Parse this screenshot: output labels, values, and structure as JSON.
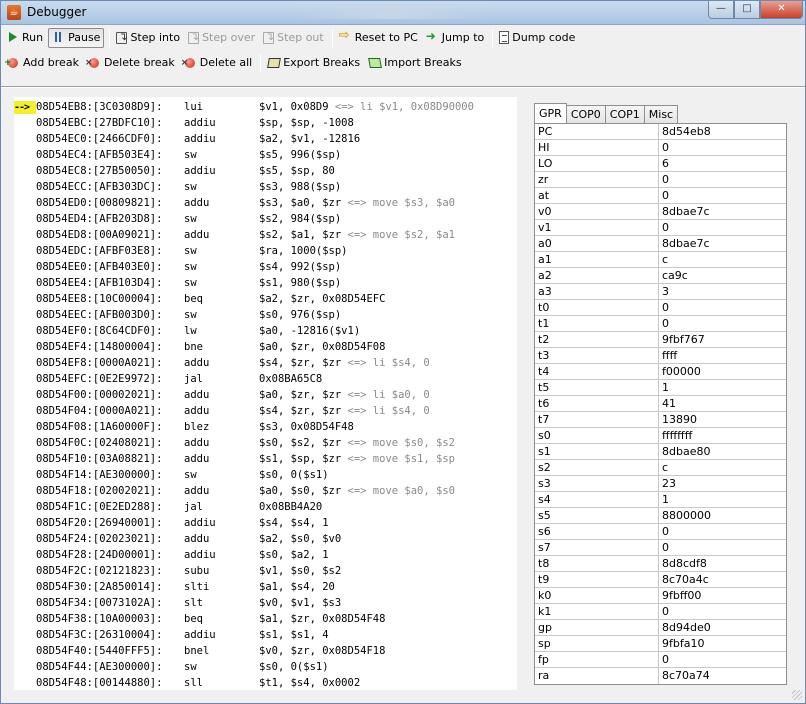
{
  "window": {
    "title": "Debugger",
    "controls": {
      "minimize": "—",
      "maximize": "□",
      "close": "✕"
    }
  },
  "toolbar1": {
    "run": "Run",
    "pause": "Pause",
    "step_into": "Step into",
    "step_over": "Step over",
    "step_out": "Step out",
    "reset_to_pc": "Reset to PC",
    "jump_to": "Jump to",
    "dump_code": "Dump code"
  },
  "toolbar2": {
    "add_break": "Add break",
    "delete_break": "Delete break",
    "delete_all": "Delete all",
    "export_breaks": "Export Breaks",
    "import_breaks": "Import Breaks"
  },
  "disassembly": {
    "pc_marker": "-->",
    "current_index": 0,
    "rows": [
      {
        "addr": "08D54EB8:[3C0308D9]:",
        "op": "lui",
        "args": "$v1, 0x08D9",
        "note": "<=> li $v1, 0x08D90000"
      },
      {
        "addr": "08D54EBC:[27BDFC10]:",
        "op": "addiu",
        "args": "$sp, $sp, -1008",
        "note": ""
      },
      {
        "addr": "08D54EC0:[2466CDF0]:",
        "op": "addiu",
        "args": "$a2, $v1, -12816",
        "note": ""
      },
      {
        "addr": "08D54EC4:[AFB503E4]:",
        "op": "sw",
        "args": "$s5, 996($sp)",
        "note": ""
      },
      {
        "addr": "08D54EC8:[27B50050]:",
        "op": "addiu",
        "args": "$s5, $sp, 80",
        "note": ""
      },
      {
        "addr": "08D54ECC:[AFB303DC]:",
        "op": "sw",
        "args": "$s3, 988($sp)",
        "note": ""
      },
      {
        "addr": "08D54ED0:[00809821]:",
        "op": "addu",
        "args": "$s3, $a0, $zr",
        "note": "<=> move $s3, $a0"
      },
      {
        "addr": "08D54ED4:[AFB203D8]:",
        "op": "sw",
        "args": "$s2, 984($sp)",
        "note": ""
      },
      {
        "addr": "08D54ED8:[00A09021]:",
        "op": "addu",
        "args": "$s2, $a1, $zr",
        "note": "<=> move $s2, $a1"
      },
      {
        "addr": "08D54EDC:[AFBF03E8]:",
        "op": "sw",
        "args": "$ra, 1000($sp)",
        "note": ""
      },
      {
        "addr": "08D54EE0:[AFB403E0]:",
        "op": "sw",
        "args": "$s4, 992($sp)",
        "note": ""
      },
      {
        "addr": "08D54EE4:[AFB103D4]:",
        "op": "sw",
        "args": "$s1, 980($sp)",
        "note": ""
      },
      {
        "addr": "08D54EE8:[10C00004]:",
        "op": "beq",
        "args": "$a2, $zr, 0x08D54EFC",
        "note": ""
      },
      {
        "addr": "08D54EEC:[AFB003D0]:",
        "op": "sw",
        "args": "$s0, 976($sp)",
        "note": ""
      },
      {
        "addr": "08D54EF0:[8C64CDF0]:",
        "op": "lw",
        "args": "$a0, -12816($v1)",
        "note": ""
      },
      {
        "addr": "08D54EF4:[14800004]:",
        "op": "bne",
        "args": "$a0, $zr, 0x08D54F08",
        "note": ""
      },
      {
        "addr": "08D54EF8:[0000A021]:",
        "op": "addu",
        "args": "$s4, $zr, $zr",
        "note": "<=> li $s4, 0"
      },
      {
        "addr": "08D54EFC:[0E2E9972]:",
        "op": "jal",
        "args": "0x08BA65C8",
        "note": ""
      },
      {
        "addr": "08D54F00:[00002021]:",
        "op": "addu",
        "args": "$a0, $zr, $zr",
        "note": "<=> li $a0, 0"
      },
      {
        "addr": "08D54F04:[0000A021]:",
        "op": "addu",
        "args": "$s4, $zr, $zr",
        "note": "<=> li $s4, 0"
      },
      {
        "addr": "08D54F08:[1A60000F]:",
        "op": "blez",
        "args": "$s3, 0x08D54F48",
        "note": ""
      },
      {
        "addr": "08D54F0C:[02408021]:",
        "op": "addu",
        "args": "$s0, $s2, $zr",
        "note": "<=> move $s0, $s2"
      },
      {
        "addr": "08D54F10:[03A08821]:",
        "op": "addu",
        "args": "$s1, $sp, $zr",
        "note": "<=> move $s1, $sp"
      },
      {
        "addr": "08D54F14:[AE300000]:",
        "op": "sw",
        "args": "$s0, 0($s1)",
        "note": ""
      },
      {
        "addr": "08D54F18:[02002021]:",
        "op": "addu",
        "args": "$a0, $s0, $zr",
        "note": "<=> move $a0, $s0"
      },
      {
        "addr": "08D54F1C:[0E2ED288]:",
        "op": "jal",
        "args": "0x08BB4A20",
        "note": ""
      },
      {
        "addr": "08D54F20:[26940001]:",
        "op": "addiu",
        "args": "$s4, $s4, 1",
        "note": ""
      },
      {
        "addr": "08D54F24:[02023021]:",
        "op": "addu",
        "args": "$a2, $s0, $v0",
        "note": ""
      },
      {
        "addr": "08D54F28:[24D00001]:",
        "op": "addiu",
        "args": "$s0, $a2, 1",
        "note": ""
      },
      {
        "addr": "08D54F2C:[02121823]:",
        "op": "subu",
        "args": "$v1, $s0, $s2",
        "note": ""
      },
      {
        "addr": "08D54F30:[2A850014]:",
        "op": "slti",
        "args": "$a1, $s4, 20",
        "note": ""
      },
      {
        "addr": "08D54F34:[0073102A]:",
        "op": "slt",
        "args": "$v0, $v1, $s3",
        "note": ""
      },
      {
        "addr": "08D54F38:[10A00003]:",
        "op": "beq",
        "args": "$a1, $zr, 0x08D54F48",
        "note": ""
      },
      {
        "addr": "08D54F3C:[26310004]:",
        "op": "addiu",
        "args": "$s1, $s1, 4",
        "note": ""
      },
      {
        "addr": "08D54F40:[5440FFF5]:",
        "op": "bnel",
        "args": "$v0, $zr, 0x08D54F18",
        "note": ""
      },
      {
        "addr": "08D54F44:[AE300000]:",
        "op": "sw",
        "args": "$s0, 0($s1)",
        "note": ""
      },
      {
        "addr": "08D54F48:[00144880]:",
        "op": "sll",
        "args": "$t1, $s4, 0x0002",
        "note": ""
      }
    ]
  },
  "register_tabs": [
    "GPR",
    "COP0",
    "COP1",
    "Misc"
  ],
  "active_tab": "GPR",
  "registers": [
    {
      "name": "PC",
      "value": "8d54eb8"
    },
    {
      "name": "HI",
      "value": "0"
    },
    {
      "name": "LO",
      "value": "6"
    },
    {
      "name": "zr",
      "value": "0"
    },
    {
      "name": "at",
      "value": "0"
    },
    {
      "name": "v0",
      "value": "8dbae7c"
    },
    {
      "name": "v1",
      "value": "0"
    },
    {
      "name": "a0",
      "value": "8dbae7c"
    },
    {
      "name": "a1",
      "value": "c"
    },
    {
      "name": "a2",
      "value": "ca9c"
    },
    {
      "name": "a3",
      "value": "3"
    },
    {
      "name": "t0",
      "value": "0"
    },
    {
      "name": "t1",
      "value": "0"
    },
    {
      "name": "t2",
      "value": "9fbf767"
    },
    {
      "name": "t3",
      "value": "ffff"
    },
    {
      "name": "t4",
      "value": "f00000"
    },
    {
      "name": "t5",
      "value": "1"
    },
    {
      "name": "t6",
      "value": "41"
    },
    {
      "name": "t7",
      "value": "13890"
    },
    {
      "name": "s0",
      "value": "ffffffff"
    },
    {
      "name": "s1",
      "value": "8dbae80"
    },
    {
      "name": "s2",
      "value": "c"
    },
    {
      "name": "s3",
      "value": "23"
    },
    {
      "name": "s4",
      "value": "1"
    },
    {
      "name": "s5",
      "value": "8800000"
    },
    {
      "name": "s6",
      "value": "0"
    },
    {
      "name": "s7",
      "value": "0"
    },
    {
      "name": "t8",
      "value": "8d8cdf8"
    },
    {
      "name": "t9",
      "value": "8c70a4c"
    },
    {
      "name": "k0",
      "value": "9fbff00"
    },
    {
      "name": "k1",
      "value": "0"
    },
    {
      "name": "gp",
      "value": "8d94de0"
    },
    {
      "name": "sp",
      "value": "9fbfa10"
    },
    {
      "name": "fp",
      "value": "0"
    },
    {
      "name": "ra",
      "value": "8c70a74"
    }
  ]
}
